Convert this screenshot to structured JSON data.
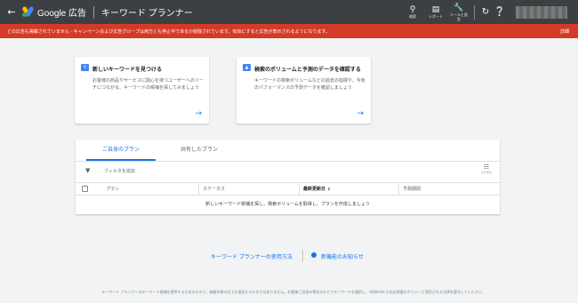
{
  "topbar": {
    "back_icon": "arrow-left-icon",
    "brand": "Google 広告",
    "product": "キーワード プランナー",
    "tools": [
      {
        "label": "検索",
        "icon": "search-icon"
      },
      {
        "label": "レポート",
        "icon": "report-icon"
      },
      {
        "label": "ツールと設定",
        "icon": "wrench-icon"
      }
    ],
    "refresh_icon": "refresh-icon",
    "help_icon": "help-icon"
  },
  "alert": {
    "message": "どの広告も掲載されていません - キャンペーンおよび広告グループは両方とも停止中であるか削除されています。有効にすると広告が表示されるようになります。",
    "details": "詳細",
    "color": "#d33b27"
  },
  "cards": {
    "discover": {
      "title": "新しいキーワードを見つける",
      "description": "お客様の商品やサービスに関心を持つユーザーへのリーチにつながる、キーワードの候補を探してみましょう",
      "icon": "search-keyword-icon"
    },
    "forecast": {
      "title": "検索のボリュームと予測のデータを確認する",
      "description": "キーワードの検索ボリュームなどの過去の指標や、今後のパフォーマンスの予測データを確認しましょう",
      "icon": "chart-icon"
    }
  },
  "plans": {
    "tabs": [
      "ご自身のプラン",
      "共有したプラン"
    ],
    "filter_label": "フィルタを追加",
    "columns_label": "表示項目",
    "headers": [
      "プラン",
      "ステータス",
      "最終更新日",
      "予測期間"
    ],
    "empty_message": "新しいキーワード候補を探し、検索ボリュームを取得し、プランを作成しましょう"
  },
  "links": {
    "how_to": "キーワード プランナーの使用方法",
    "news": "新機能のお知らせ"
  },
  "footer": "キーワード プランナーはキーワード候補を提供するためのもので、価格効果の向上を保証するものではありません。お客様ご自身の責任のもとでキーワードを選択し、AdWords の広告掲載のポリシーと適用される法律を遵守してください。",
  "colors": {
    "accent": "#1a73e8",
    "topbar": "#3c4043"
  }
}
